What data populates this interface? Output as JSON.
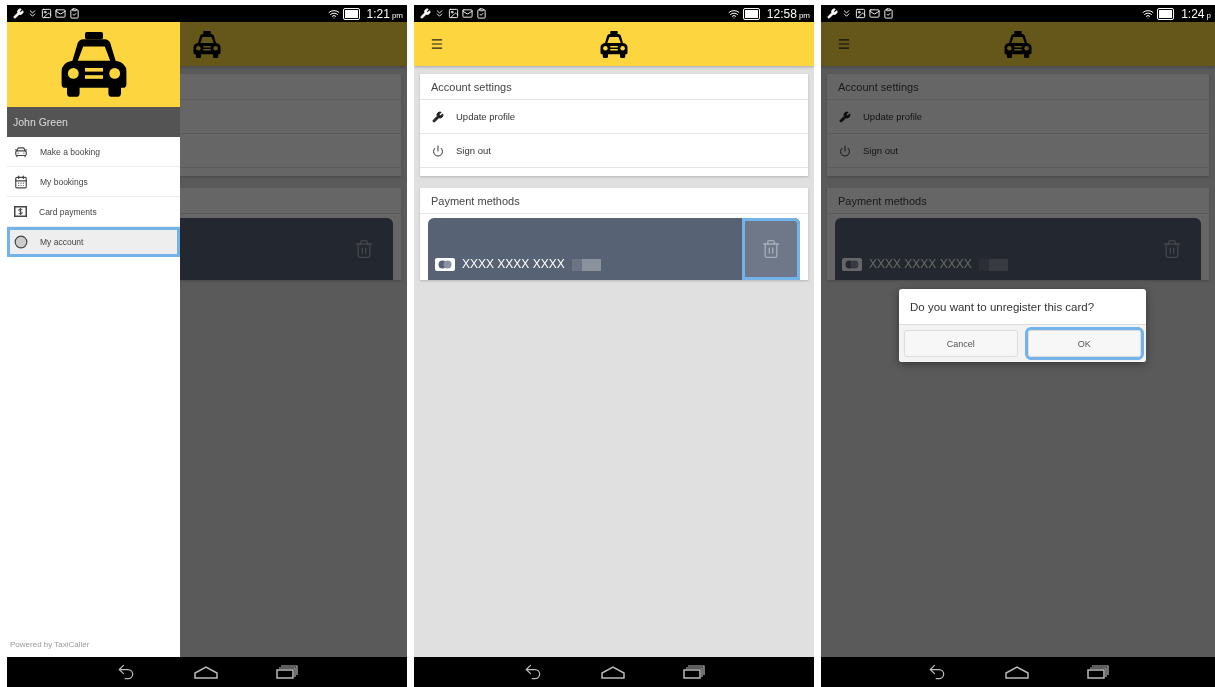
{
  "screens": [
    {
      "kind": "drawer",
      "status": {
        "time": "1:21",
        "suffix": "pm"
      },
      "drawer": {
        "user": "John Green",
        "items": [
          {
            "label": "Make a booking",
            "selected": false,
            "highlighted": false
          },
          {
            "label": "My bookings",
            "selected": false,
            "highlighted": false
          },
          {
            "label": "Card payments",
            "selected": false,
            "highlighted": false
          },
          {
            "label": "My account",
            "selected": true,
            "highlighted": true
          }
        ],
        "footer": "Powered by TaxiCaller"
      }
    },
    {
      "kind": "page",
      "status": {
        "time": "12:58",
        "suffix": "pm"
      },
      "settings": {
        "title": "Account settings",
        "items": [
          {
            "label": "Update profile"
          },
          {
            "label": "Sign out"
          }
        ]
      },
      "payment": {
        "title": "Payment methods",
        "card_number": "XXXX XXXX XXXX",
        "delete_highlighted": true
      }
    },
    {
      "kind": "dialog",
      "status": {
        "time": "1:24",
        "suffix": "p"
      },
      "settings": {
        "title": "Account settings",
        "items": [
          {
            "label": "Update profile"
          },
          {
            "label": "Sign out"
          }
        ]
      },
      "payment": {
        "title": "Payment methods",
        "card_number": "XXXX XXXX XXXX",
        "delete_highlighted": false
      },
      "dialog": {
        "message": "Do you want to unregister this card?",
        "buttons": [
          {
            "label": "Cancel",
            "highlighted": false
          },
          {
            "label": "OK",
            "highlighted": true
          }
        ]
      }
    }
  ]
}
